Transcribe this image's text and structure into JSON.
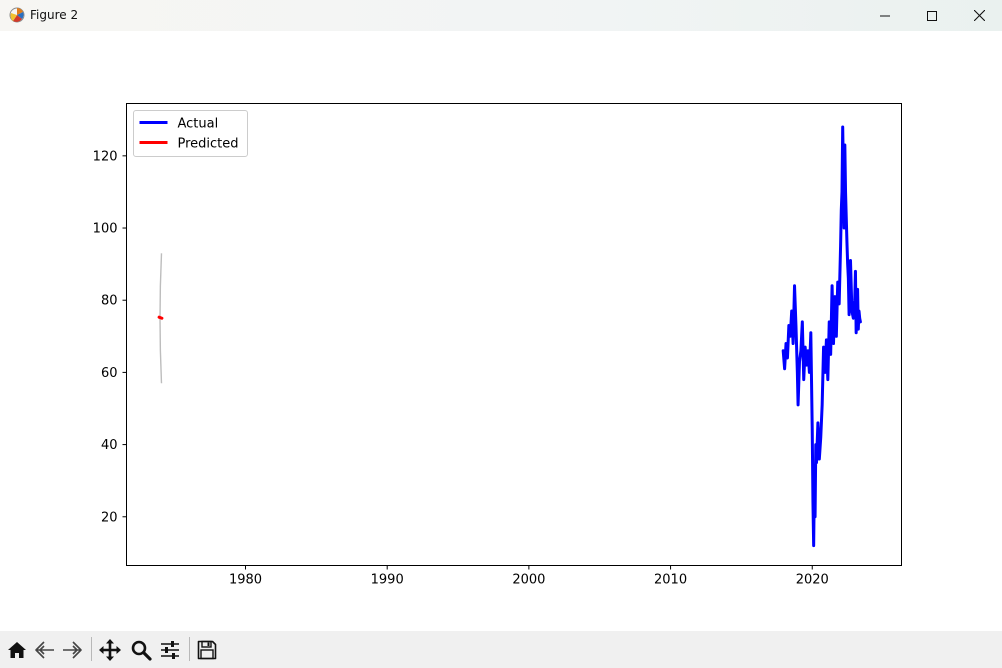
{
  "window": {
    "title": "Figure 2",
    "icons": {
      "app": "matplotlib-figure-icon",
      "minimize": "minimize-icon",
      "maximize": "maximize-icon",
      "close": "close-icon"
    }
  },
  "toolbar": {
    "buttons": [
      {
        "name": "home",
        "icon": "home-icon"
      },
      {
        "name": "back",
        "icon": "back-arrow-icon"
      },
      {
        "name": "forward",
        "icon": "forward-arrow-icon"
      },
      {
        "name": "pan",
        "icon": "move-icon"
      },
      {
        "name": "zoom",
        "icon": "zoom-icon"
      },
      {
        "name": "configure-subplots",
        "icon": "sliders-icon"
      },
      {
        "name": "save",
        "icon": "save-icon"
      }
    ]
  },
  "chart_data": {
    "type": "line",
    "title": "",
    "xlabel": "",
    "ylabel": "",
    "xlim": [
      1971.6,
      2026.3
    ],
    "ylim": [
      6.5,
      134.5
    ],
    "xticks": [
      1980,
      1990,
      2000,
      2010,
      2020
    ],
    "yticks": [
      20,
      40,
      60,
      80,
      100,
      120
    ],
    "grid": false,
    "legend": {
      "position": "top-left",
      "entries": [
        "Actual",
        "Predicted"
      ]
    },
    "colors": {
      "Actual": "#0000ff",
      "Predicted": "#ff0000",
      "interval": "#bdbdbd"
    },
    "series": [
      {
        "name": "Actual",
        "color": "#0000ff",
        "x": [
          2017.95,
          2018.05,
          2018.15,
          2018.25,
          2018.35,
          2018.45,
          2018.55,
          2018.65,
          2018.75,
          2018.85,
          2018.95,
          2019.0,
          2019.1,
          2019.2,
          2019.3,
          2019.4,
          2019.5,
          2019.6,
          2019.7,
          2019.8,
          2019.9,
          2020.0,
          2020.05,
          2020.1,
          2020.15,
          2020.2,
          2020.25,
          2020.3,
          2020.4,
          2020.5,
          2020.6,
          2020.7,
          2020.8,
          2020.9,
          2021.0,
          2021.1,
          2021.2,
          2021.3,
          2021.4,
          2021.5,
          2021.6,
          2021.7,
          2021.8,
          2021.9,
          2022.0,
          2022.05,
          2022.1,
          2022.15,
          2022.2,
          2022.25,
          2022.3,
          2022.35,
          2022.4,
          2022.45,
          2022.5,
          2022.55,
          2022.6,
          2022.65,
          2022.7,
          2022.75,
          2022.8,
          2022.9,
          2023.0,
          2023.05,
          2023.1,
          2023.15,
          2023.2,
          2023.25,
          2023.3,
          2023.35,
          2023.4
        ],
        "y": [
          66,
          61,
          68,
          64,
          73,
          70,
          77,
          68,
          84,
          73,
          60,
          51,
          63,
          66,
          74,
          58,
          67,
          62,
          66,
          60,
          71,
          44,
          24,
          12,
          30,
          20,
          40,
          35,
          46,
          36,
          42,
          51,
          67,
          60,
          69,
          58,
          74,
          65,
          84,
          68,
          81,
          70,
          85,
          79,
          95,
          105,
          110,
          128,
          115,
          100,
          123,
          110,
          103,
          96,
          90,
          86,
          76,
          82,
          91,
          84,
          77,
          75,
          80,
          88,
          71,
          79,
          83,
          72,
          77,
          75,
          74
        ]
      },
      {
        "name": "Predicted",
        "color": "#ff0000",
        "x": [
          1973.9,
          1974.1
        ],
        "y": [
          75.3,
          75.0
        ],
        "interval": {
          "low": 57,
          "high": 93
        }
      }
    ]
  }
}
